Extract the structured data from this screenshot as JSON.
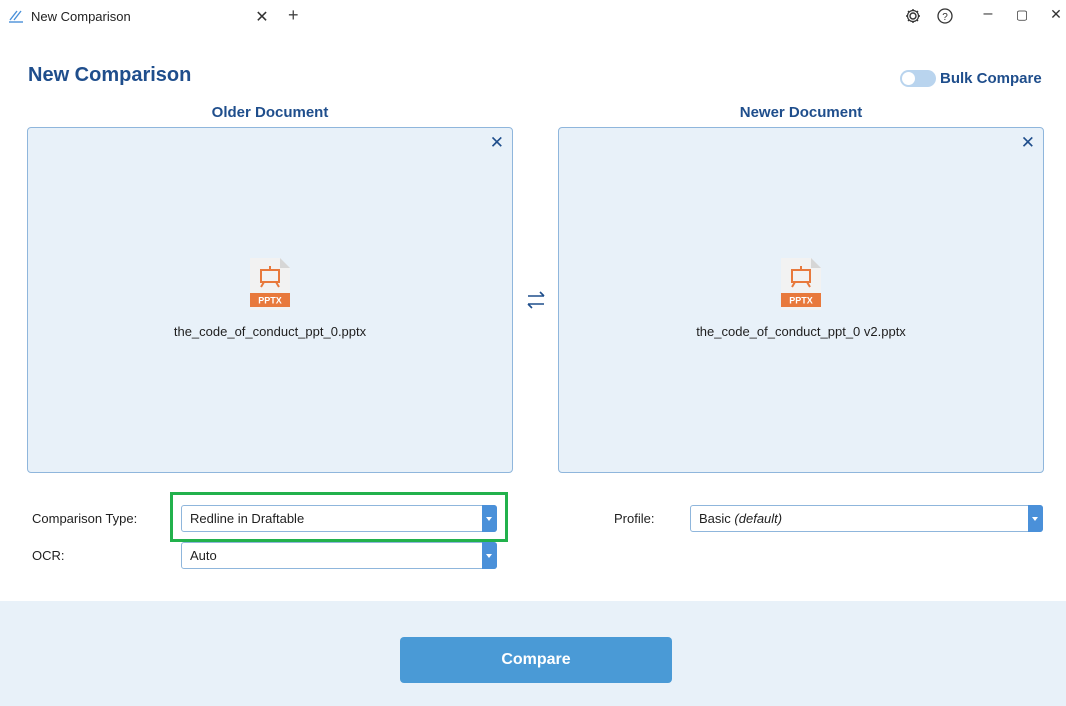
{
  "tab": {
    "title": "New Comparison",
    "icon": "draftable-logo-icon"
  },
  "window_controls": {
    "settings_icon": "gear-icon",
    "help_icon": "help-icon",
    "minimize": "–",
    "maximize": "▢",
    "close": "✕"
  },
  "page": {
    "title": "New Comparison",
    "bulk_compare_label": "Bulk Compare",
    "bulk_compare_on": false
  },
  "older": {
    "header": "Older Document",
    "file_name": "the_code_of_conduct_ppt_0.pptx",
    "file_badge": "PPTX"
  },
  "newer": {
    "header": "Newer Document",
    "file_name": "the_code_of_conduct_ppt_0 v2.pptx",
    "file_badge": "PPTX"
  },
  "form": {
    "comparison_type_label": "Comparison Type:",
    "comparison_type_value": "Redline in Draftable",
    "ocr_label": "OCR:",
    "ocr_value": "Auto",
    "profile_label": "Profile:",
    "profile_value": "Basic",
    "profile_suffix": "(default)"
  },
  "actions": {
    "compare_label": "Compare"
  },
  "colors": {
    "brand_blue": "#1f4e8c",
    "accent_blue": "#4a9ad6",
    "panel_bg": "#e8f1f9",
    "highlight": "#22b14c",
    "pptx_orange": "#e8793c"
  }
}
